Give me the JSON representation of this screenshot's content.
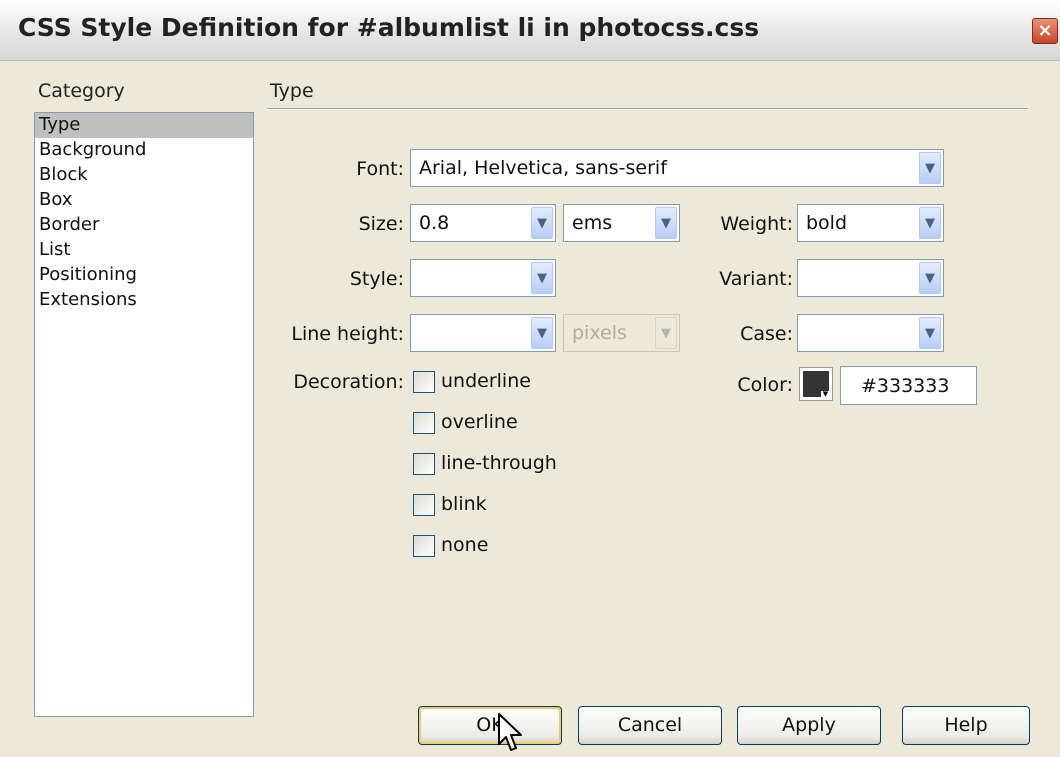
{
  "window": {
    "title": "CSS Style Definition for #albumlist li in photocss.css",
    "close_glyph": "×"
  },
  "category": {
    "label": "Category",
    "items": [
      "Type",
      "Background",
      "Block",
      "Box",
      "Border",
      "List",
      "Positioning",
      "Extensions"
    ],
    "selected": "Type"
  },
  "section": {
    "title": "Type"
  },
  "font": {
    "label": "Font:",
    "value": "Arial, Helvetica, sans-serif"
  },
  "size": {
    "label": "Size:",
    "value": "0.8",
    "unit": "ems"
  },
  "weight": {
    "label": "Weight:",
    "value": "bold"
  },
  "style": {
    "label": "Style:",
    "value": ""
  },
  "variant": {
    "label": "Variant:",
    "value": ""
  },
  "line_height": {
    "label": "Line height:",
    "value": "",
    "unit": "pixels"
  },
  "case": {
    "label": "Case:",
    "value": ""
  },
  "decoration": {
    "label": "Decoration:",
    "options": [
      "underline",
      "overline",
      "line-through",
      "blink",
      "none"
    ]
  },
  "color": {
    "label": "Color:",
    "value": "#333333",
    "swatch": "#333333"
  },
  "buttons": {
    "ok": "OK",
    "cancel": "Cancel",
    "apply": "Apply",
    "help": "Help"
  },
  "icons": {
    "dropdown": "chevron-down-icon",
    "close": "close-icon",
    "cursor": "mouse-pointer-icon"
  }
}
